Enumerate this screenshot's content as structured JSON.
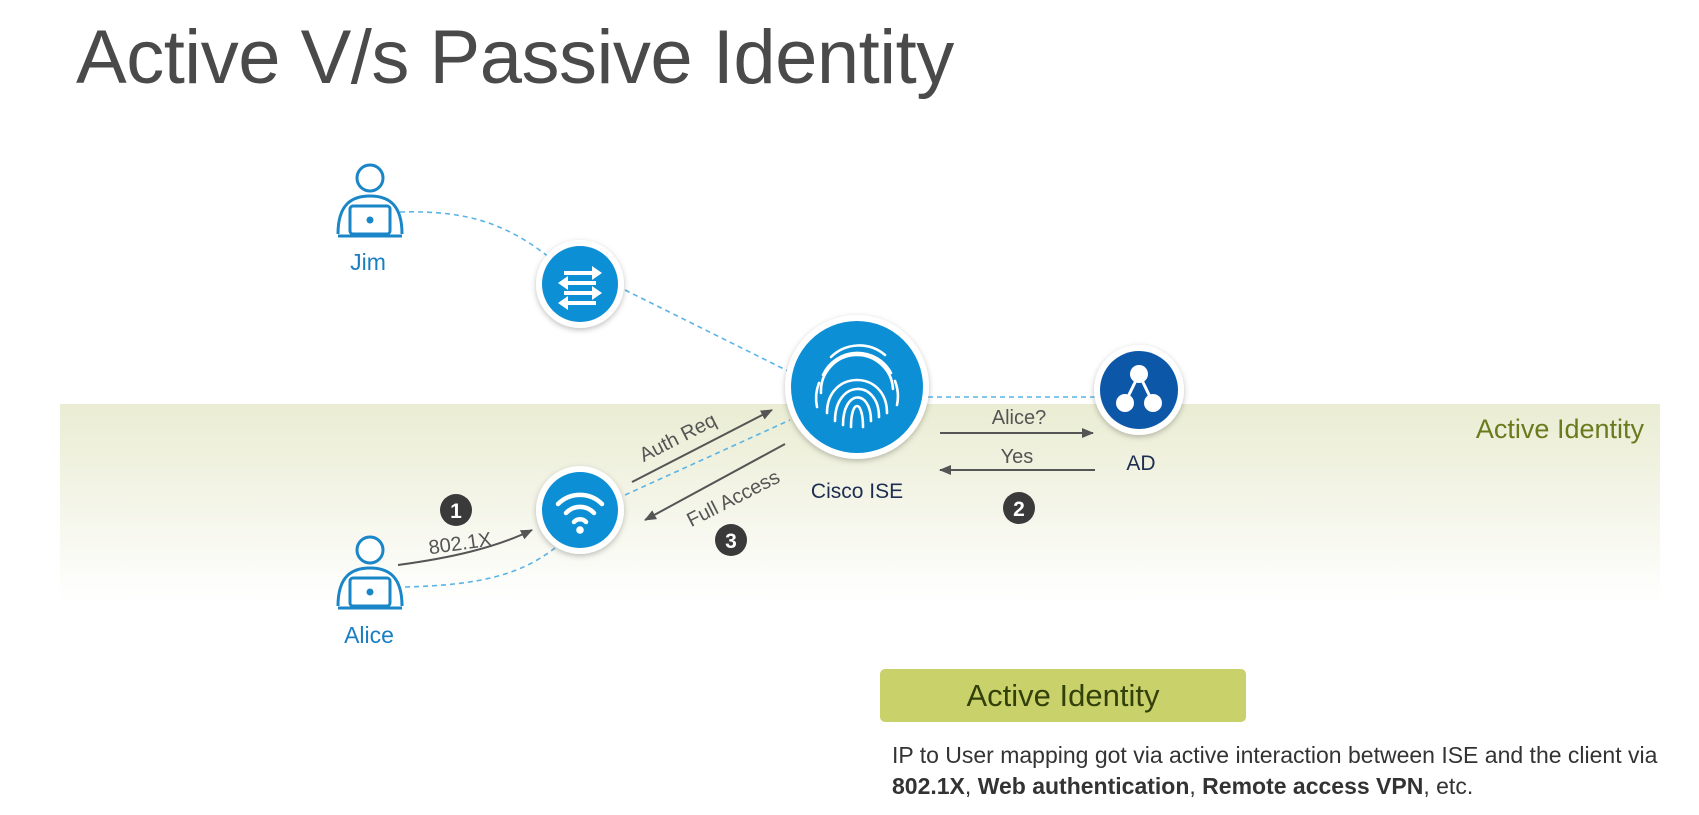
{
  "title": "Active V/s Passive Identity",
  "band_label": "Active Identity",
  "nodes": {
    "jim": "Jim",
    "alice": "Alice",
    "ise": "Cisco ISE",
    "ad": "AD"
  },
  "flows": {
    "step1_num": "1",
    "step1_label": "802.1X",
    "auth_req": "Auth Req",
    "full_access": "Full Access",
    "step3_num": "3",
    "alice_query": "Alice?",
    "yes": "Yes",
    "step2_num": "2"
  },
  "callout": {
    "title": "Active Identity",
    "desc_prefix": "IP to User mapping got via active interaction between ISE and the client via ",
    "term1": "802.1X",
    "sep1": ", ",
    "term2": "Web authentication",
    "sep2": ", ",
    "term3": "Remote access VPN",
    "desc_suffix": ", etc."
  },
  "icons": {
    "switch": "switch-icon",
    "wireless": "wifi-icon",
    "ise": "fingerprint-icon",
    "ad": "directory-icon",
    "user": "user-laptop-icon"
  },
  "colors": {
    "icon_blue": "#0d8fd6",
    "label_blue": "#1a7ec2",
    "band_label": "#6b7a1c",
    "callout_bg": "#c9d26a",
    "link_dashed": "#5ab4e5"
  }
}
